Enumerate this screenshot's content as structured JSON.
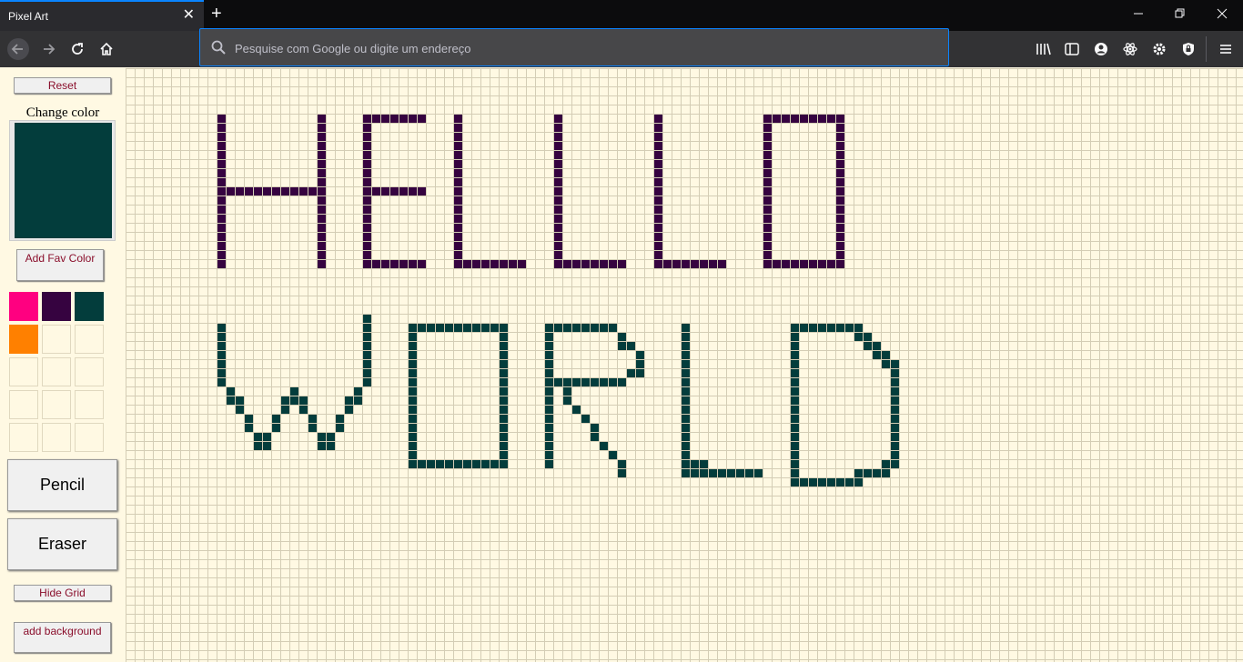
{
  "browser": {
    "tab_title": "Pixel Art",
    "tab_close": "✕",
    "new_tab": "+",
    "url_placeholder": "Pesquise com Google ou digite um endereço"
  },
  "sidebar": {
    "reset_label": "Reset",
    "change_color_label": "Change color",
    "current_color": "#033d3c",
    "add_fav_label": "Add Fav Color",
    "fav_colors": [
      "#ff0080",
      "#360340",
      "#033d3c",
      "#ff8000",
      "",
      "",
      "",
      "",
      "",
      "",
      "",
      "",
      "",
      "",
      ""
    ],
    "pencil_label": "Pencil",
    "eraser_label": "Eraser",
    "hide_grid_label": "Hide Grid",
    "add_background_label": "add background"
  },
  "canvas": {
    "text_line_1": "HELLLO",
    "text_line_2": "WORLD",
    "line_1_color": "#360340",
    "line_2_color": "#033d3c",
    "grid_color": "#d4cdb5",
    "background_color": "#fff9e3"
  }
}
